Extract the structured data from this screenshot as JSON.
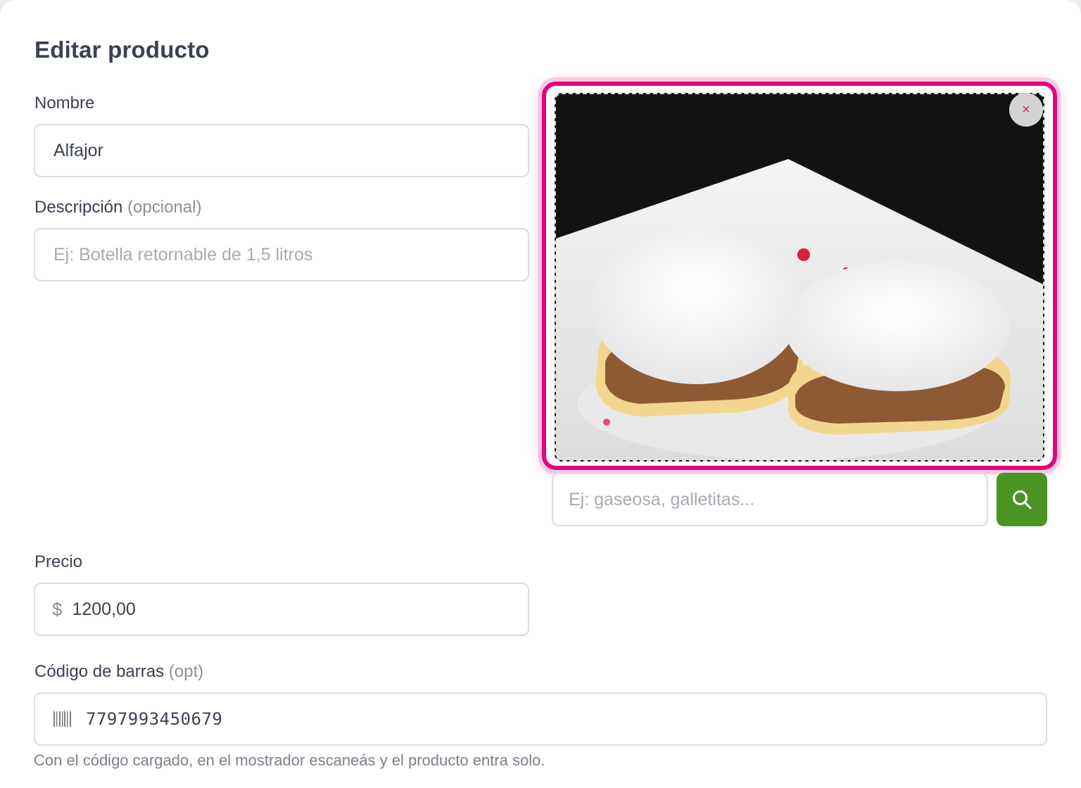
{
  "title": "Editar producto",
  "name": {
    "label": "Nombre",
    "value": "Alfajor"
  },
  "description": {
    "label": "Descripción",
    "optional": "(opcional)",
    "placeholder": "Ej: Botella retornable de 1,5 litros"
  },
  "image": {
    "close_symbol": "×",
    "search_placeholder": "Ej: gaseosa, galletitas..."
  },
  "price": {
    "label": "Precio",
    "currency": "$",
    "value": "1200,00"
  },
  "barcode": {
    "label": "Código de barras",
    "optional": "(opt)",
    "value": "7797993450679",
    "helper": "Con el código cargado, en el mostrador escaneás y el producto entra solo."
  },
  "icons": {
    "search": "search-icon",
    "barcode": "barcode-icon",
    "close": "close-icon"
  },
  "colors": {
    "accent_pink": "#e0077d",
    "search_green": "#4a9424",
    "close_red": "#e0245e"
  }
}
